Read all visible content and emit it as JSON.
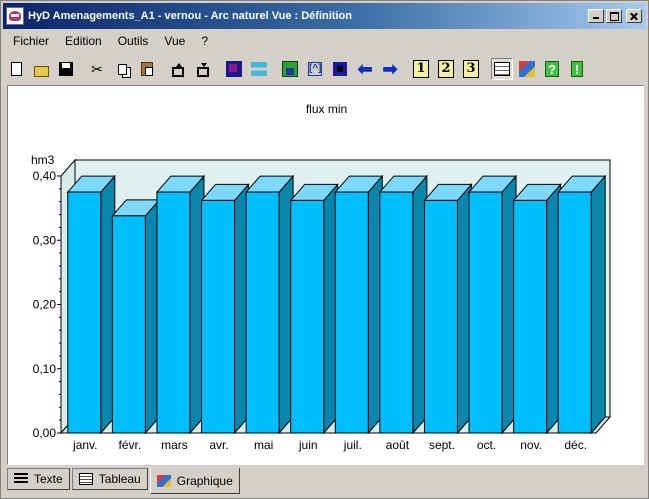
{
  "window": {
    "title": "HyD Amenagements_A1 - vernou - Arc naturel Vue  : Définition"
  },
  "menu": [
    "Fichier",
    "Edition",
    "Outils",
    "Vue",
    "?"
  ],
  "toolbar": {
    "groups": [
      [
        "new-file-icon",
        "open-folder-icon",
        "save-icon",
        "cut-icon",
        "copy-icon",
        "paste-icon",
        "move-up-icon",
        "move-down-icon"
      ],
      [
        "multi-icon",
        "swap-icon"
      ],
      [
        "green-grid-icon",
        "bracket-icon",
        "blue-grid-icon",
        "arrow-left-icon",
        "arrow-right-icon"
      ],
      [
        "view-1-icon",
        "view-2-icon",
        "view-3-icon"
      ],
      [
        "table-view-icon",
        "graph-view-icon",
        "help-icon",
        "exclamation-icon"
      ]
    ],
    "view_labels": [
      "1",
      "2",
      "3"
    ],
    "help_glyph": "?",
    "excl_glyph": "!"
  },
  "chart_data": {
    "type": "bar",
    "title": "flux min",
    "ylabel": "hm3",
    "xlabel": "",
    "categories": [
      "janv.",
      "févr.",
      "mars",
      "avr.",
      "mai",
      "juin",
      "juil.",
      "août",
      "sept.",
      "oct.",
      "nov.",
      "déc."
    ],
    "values": [
      0.375,
      0.338,
      0.375,
      0.362,
      0.375,
      0.362,
      0.375,
      0.375,
      0.362,
      0.375,
      0.362,
      0.375
    ],
    "ylim": [
      0,
      0.4
    ],
    "yticks": [
      "0,00",
      "0,10",
      "0,20",
      "0,30",
      "0,40"
    ],
    "grid": false,
    "style": "3d-bar",
    "bar_color": "#00bfff",
    "bar_top_color": "#7dd9fb",
    "bar_side_color": "#0a86ac",
    "wall_color": "#e0f0f0"
  },
  "tabs": [
    {
      "label": "Texte",
      "active": false
    },
    {
      "label": "Tableau",
      "active": false
    },
    {
      "label": "Graphique",
      "active": true
    }
  ]
}
